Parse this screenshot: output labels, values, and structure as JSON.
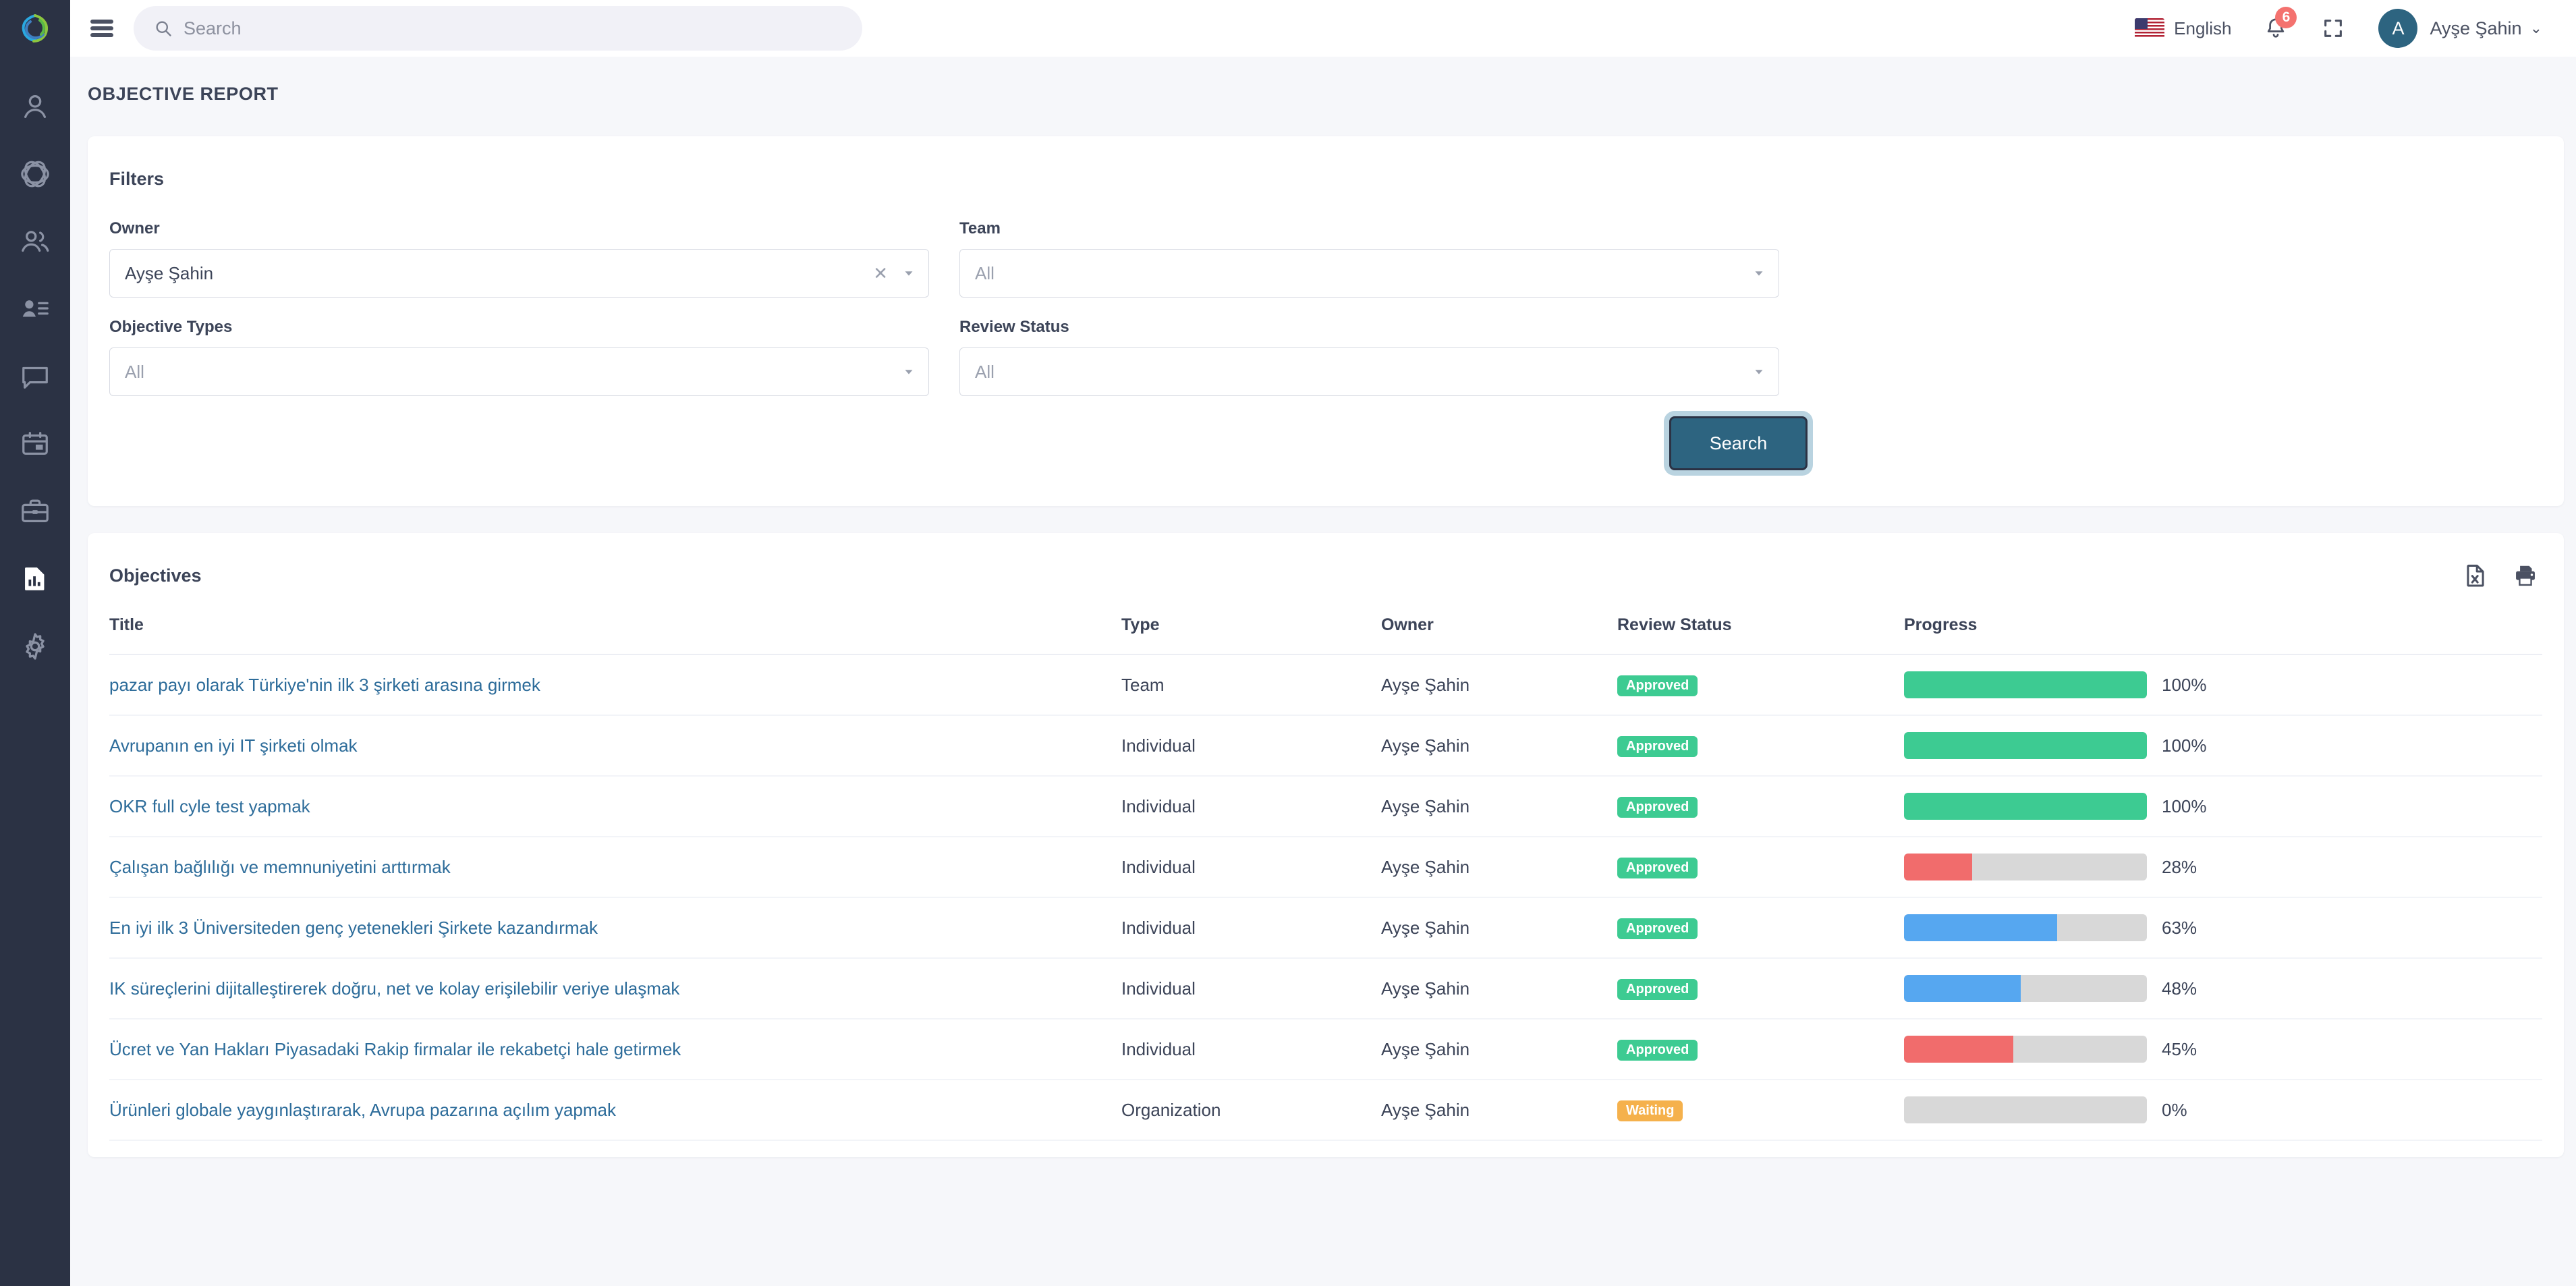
{
  "brand": {
    "logo_name": "okr-swirl-logo"
  },
  "sidebar": {
    "items": [
      {
        "icon": "user-icon",
        "name": "sidebar-item-profile",
        "active": false
      },
      {
        "icon": "aperture-icon",
        "name": "sidebar-item-objectives",
        "active": false
      },
      {
        "icon": "people-icon",
        "name": "sidebar-item-teams",
        "active": false
      },
      {
        "icon": "contact-card-icon",
        "name": "sidebar-item-employees",
        "active": false
      },
      {
        "icon": "chat-icon",
        "name": "sidebar-item-feedback",
        "active": false
      },
      {
        "icon": "calendar-icon",
        "name": "sidebar-item-calendar",
        "active": false
      },
      {
        "icon": "briefcase-icon",
        "name": "sidebar-item-jobs",
        "active": false
      },
      {
        "icon": "report-icon",
        "name": "sidebar-item-reports",
        "active": true
      },
      {
        "icon": "gear-icon",
        "name": "sidebar-item-settings",
        "active": false
      }
    ]
  },
  "header": {
    "menu_toggle": "hamburger-icon",
    "search": {
      "value": "",
      "placeholder": "Search",
      "icon": "search-icon"
    },
    "language": {
      "label": "English",
      "flag": "us-flag"
    },
    "notifications": {
      "icon": "bell-icon",
      "count": "6"
    },
    "fullscreen": {
      "icon": "fullscreen-icon"
    },
    "user": {
      "initial": "A",
      "name": "Ayşe Şahin",
      "caret": "⌄"
    }
  },
  "page": {
    "title": "OBJECTIVE REPORT"
  },
  "filters": {
    "title": "Filters",
    "fields": [
      {
        "label": "Owner",
        "value": "Ayşe Şahin",
        "is_placeholder": false,
        "clearable": true
      },
      {
        "label": "Team",
        "value": "All",
        "is_placeholder": true,
        "clearable": false
      },
      {
        "label": "Objective Types",
        "value": "All",
        "is_placeholder": true,
        "clearable": false
      },
      {
        "label": "Review Status",
        "value": "All",
        "is_placeholder": true,
        "clearable": false
      }
    ],
    "search_button": "Search"
  },
  "objectives": {
    "title": "Objectives",
    "actions": [
      {
        "name": "export-excel-button",
        "icon": "excel-file-icon"
      },
      {
        "name": "print-button",
        "icon": "printer-icon"
      }
    ],
    "columns": [
      "Title",
      "Type",
      "Owner",
      "Review Status",
      "Progress"
    ],
    "rows": [
      {
        "title": "pazar payı olarak Türkiye'nin ilk 3 şirketi arasına girmek",
        "type": "Team",
        "owner": "Ayşe Şahin",
        "review_status": "Approved",
        "status_kind": "approved",
        "progress": 100,
        "progress_label": "100%",
        "bar_color": "#3dcb92"
      },
      {
        "title": "Avrupanın en iyi IT şirketi olmak",
        "type": "Individual",
        "owner": "Ayşe Şahin",
        "review_status": "Approved",
        "status_kind": "approved",
        "progress": 100,
        "progress_label": "100%",
        "bar_color": "#3dcb92"
      },
      {
        "title": "OKR full cyle test yapmak",
        "type": "Individual",
        "owner": "Ayşe Şahin",
        "review_status": "Approved",
        "status_kind": "approved",
        "progress": 100,
        "progress_label": "100%",
        "bar_color": "#3dcb92"
      },
      {
        "title": "Çalışan bağlılığı ve memnuniyetini arttırmak",
        "type": "Individual",
        "owner": "Ayşe Şahin",
        "review_status": "Approved",
        "status_kind": "approved",
        "progress": 28,
        "progress_label": "28%",
        "bar_color": "#f16c6c"
      },
      {
        "title": "En iyi ilk 3 Üniversiteden genç yetenekleri Şirkete kazandırmak",
        "type": "Individual",
        "owner": "Ayşe Şahin",
        "review_status": "Approved",
        "status_kind": "approved",
        "progress": 63,
        "progress_label": "63%",
        "bar_color": "#56a7f0"
      },
      {
        "title": "IK süreçlerini dijitalleştirerek doğru, net ve kolay erişilebilir veriye ulaşmak",
        "type": "Individual",
        "owner": "Ayşe Şahin",
        "review_status": "Approved",
        "status_kind": "approved",
        "progress": 48,
        "progress_label": "48%",
        "bar_color": "#56a7f0"
      },
      {
        "title": "Ücret ve Yan Hakları Piyasadaki Rakip firmalar ile rekabetçi hale getirmek",
        "type": "Individual",
        "owner": "Ayşe Şahin",
        "review_status": "Approved",
        "status_kind": "approved",
        "progress": 45,
        "progress_label": "45%",
        "bar_color": "#f16c6c"
      },
      {
        "title": "Ürünleri globale yaygınlaştırarak, Avrupa pazarına açılım yapmak",
        "type": "Organization",
        "owner": "Ayşe Şahin",
        "review_status": "Waiting",
        "status_kind": "waiting",
        "progress": 0,
        "progress_label": "0%",
        "bar_color": "#d8d8d8"
      }
    ]
  },
  "colors": {
    "sidebar_bg": "#2b3244",
    "page_bg": "#f6f7fa",
    "accent": "#2d6480",
    "link": "#2d6c9a",
    "approved": "#3dcb92",
    "waiting": "#f5b14c",
    "bar_red": "#f16c6c",
    "bar_blue": "#56a7f0",
    "bar_track": "#d8d8d8",
    "badge_red": "#f4726f"
  }
}
